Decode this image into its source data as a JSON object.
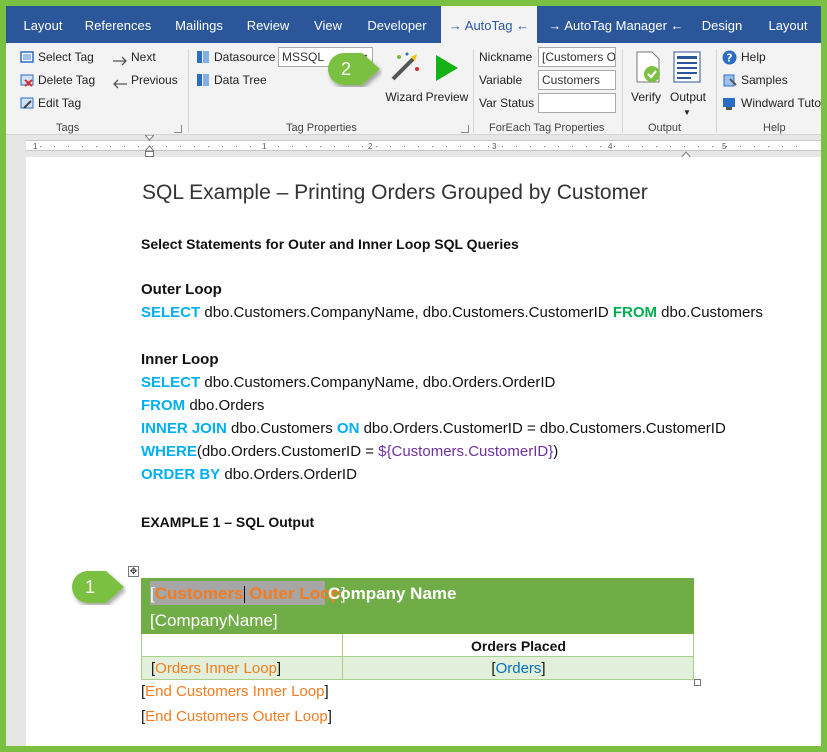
{
  "tabs": [
    {
      "label": "Layout",
      "active": false
    },
    {
      "label": "References",
      "active": false
    },
    {
      "label": "Mailings",
      "active": false
    },
    {
      "label": "Review",
      "active": false
    },
    {
      "label": "View",
      "active": false
    },
    {
      "label": "Developer",
      "active": false
    },
    {
      "label": "→ AutoTag ←",
      "active": true
    },
    {
      "label": "→ AutoTag Manager ←",
      "active": false
    },
    {
      "label": "Design",
      "active": false
    },
    {
      "label": "Layout",
      "active": false
    }
  ],
  "ribbon": {
    "tags_group": {
      "label": "Tags",
      "select_tag": "Select Tag",
      "delete_tag": "Delete Tag",
      "edit_tag": "Edit Tag",
      "next": "Next",
      "previous": "Previous"
    },
    "tag_properties_group": {
      "label": "Tag Properties",
      "datasource_label": "Datasource",
      "datasource_value": "MSSQL",
      "data_tree": "Data Tree",
      "wizard": "Wizard",
      "preview": "Preview"
    },
    "foreach_group": {
      "label": "ForEach Tag Properties",
      "nickname_label": "Nickname",
      "nickname_value": "[Customers O",
      "variable_label": "Variable",
      "variable_value": "Customers",
      "var_status_label": "Var Status",
      "var_status_value": ""
    },
    "output_group": {
      "label": "Output",
      "verify": "Verify",
      "output": "Output"
    },
    "help_group": {
      "label": "Help",
      "help": "Help",
      "samples": "Samples",
      "windward": "Windward Tuto"
    }
  },
  "ruler": {
    "numbers": [
      "1",
      "1",
      "2",
      "3",
      "4",
      "5"
    ]
  },
  "document": {
    "title": "SQL Example – Printing Orders Grouped by Customer",
    "section_heading": "Select Statements for Outer and Inner Loop SQL Queries",
    "outer_loop_heading": "Outer Loop",
    "outer_select_kw": "SELECT",
    "outer_select_cols": " dbo.Customers.CompanyName, dbo.Customers.CustomerID ",
    "outer_from_kw": "FROM",
    "outer_from_table": " dbo.Customers",
    "inner_loop_heading": "Inner Loop",
    "inner_select_kw": "SELECT",
    "inner_select_cols": " dbo.Customers.CompanyName, dbo.Orders.OrderID",
    "inner_from_kw": "FROM",
    "inner_from_table": " dbo.Orders",
    "inner_join_kw": "INNER JOIN",
    "inner_join_table": " dbo.Customers ",
    "on_kw": "ON",
    "on_clause": " dbo.Orders.CustomerID = dbo.Customers.CustomerID",
    "where_kw": "WHERE",
    "where_clause": "(dbo.Orders.CustomerID = ",
    "where_var": "${Customers.CustomerID}",
    "where_close": ")",
    "order_by_kw": "ORDER BY",
    "order_by_clause": " dbo.Orders.OrderID",
    "example_heading": "EXAMPLE 1 – SQL Output",
    "table": {
      "outer_tag_part1": "Customers",
      "outer_tag_part2": " Outer Loop",
      "company_name_header": "Company Name",
      "company_name_field": "[CompanyName]",
      "orders_placed_header": "Orders Placed",
      "inner_tag": "Orders Inner Loop",
      "orders_tag": "Orders"
    },
    "end_inner": "End Customers Inner Loop",
    "end_outer": "End Customers Outer Loop"
  },
  "callouts": [
    {
      "number": "1"
    },
    {
      "number": "2"
    }
  ],
  "colors": {
    "accent_frame": "#7ac143",
    "tab_bar": "#2b579a",
    "sql_keyword": "#00b0f0",
    "sql_keyword_from": "#00b050",
    "variable": "#7030a0",
    "tag": "#f47b20",
    "table_header": "#70ad47",
    "table_row": "#e2efda"
  }
}
